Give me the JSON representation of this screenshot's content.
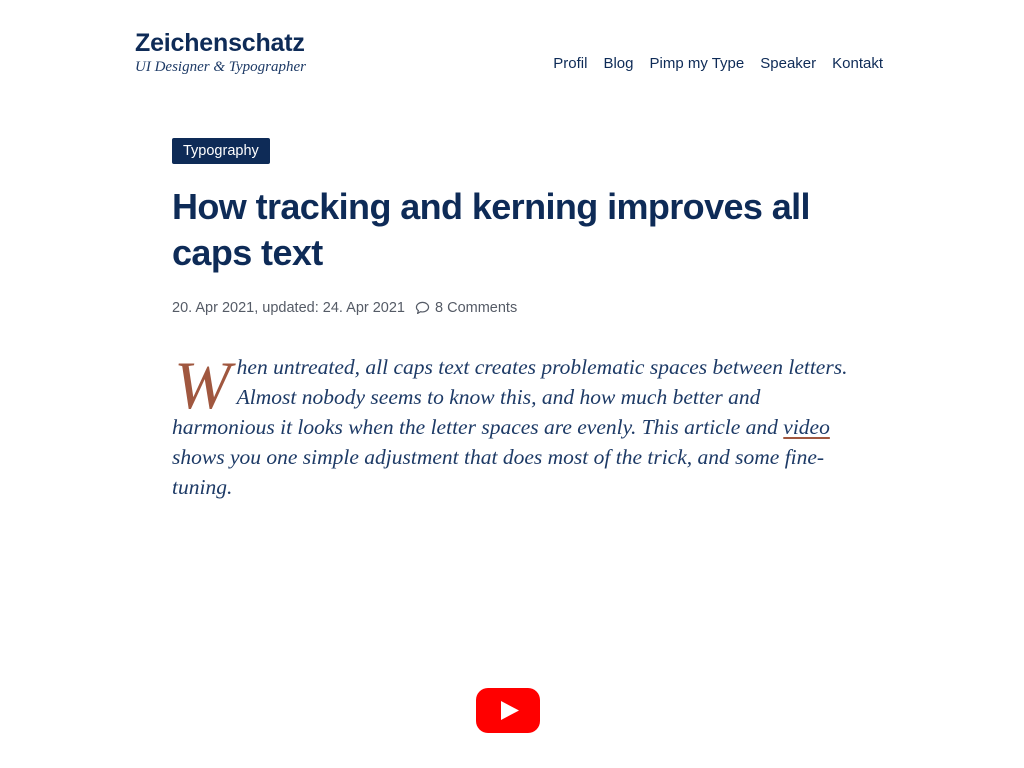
{
  "site": {
    "name": "Zeichenschatz",
    "tagline": "UI Designer & Typographer"
  },
  "nav": {
    "items": [
      {
        "label": "Profil"
      },
      {
        "label": "Blog"
      },
      {
        "label": "Pimp my Type"
      },
      {
        "label": "Speaker"
      },
      {
        "label": "Kontakt"
      }
    ]
  },
  "article": {
    "category": "Typography",
    "title": "How tracking and kerning improves all caps text",
    "meta": {
      "dates": "20. Apr 2021, updated: 24. Apr 2021",
      "comments": "8 Comments",
      "comment_icon": "speech-bubble-icon"
    },
    "lead": {
      "drop_cap": "W",
      "part1": "hen untreated, all caps text creates problematic spaces between letters. Almost nobody seems to know this, and how much better and harmonious it looks when the letter spaces are evenly. This article and ",
      "link_text": "video",
      "part2": " shows you one simple adjustment that does most of the trick, and some fine-tuning."
    }
  },
  "video": {
    "icon": "youtube-play-icon"
  },
  "colors": {
    "navy": "#0e2b57",
    "accent": "#a0573f",
    "meta_text": "#555b66",
    "youtube_red": "#ff0000"
  }
}
